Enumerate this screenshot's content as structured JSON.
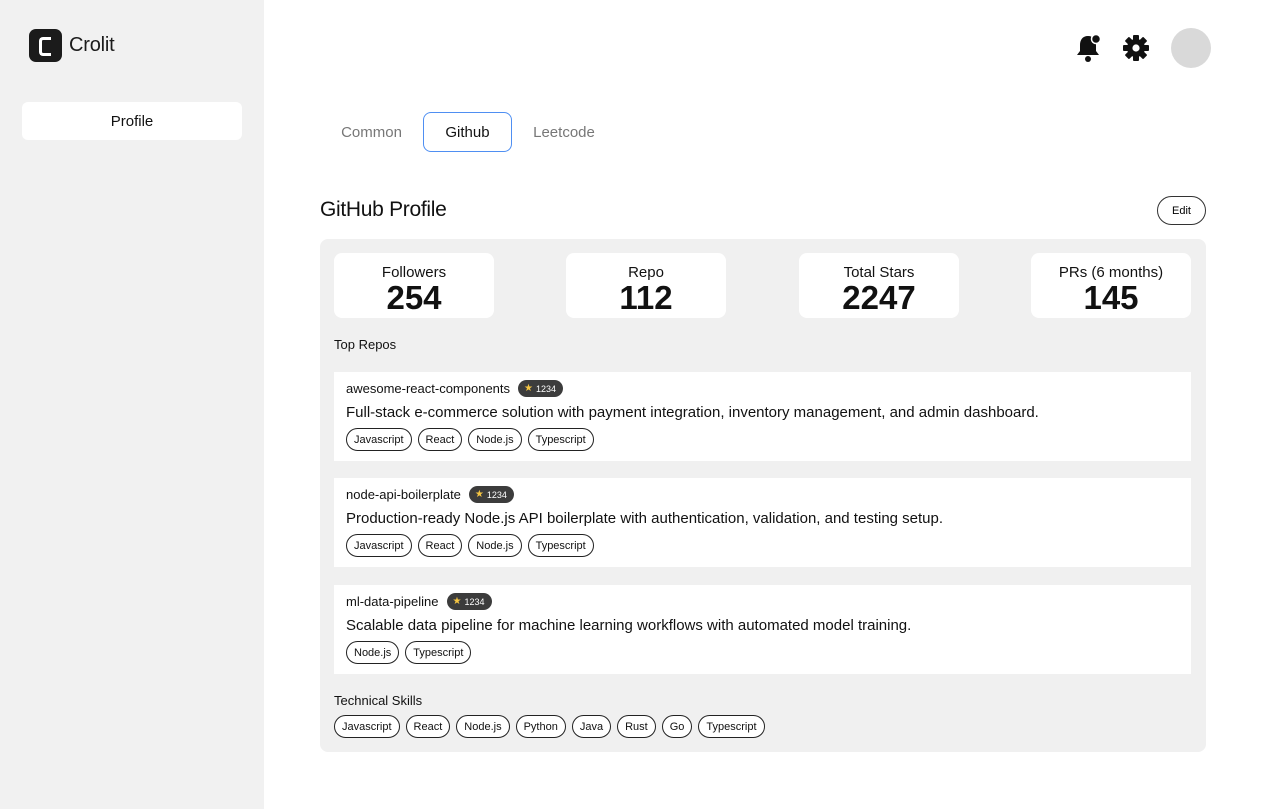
{
  "app": {
    "name": "Crolit"
  },
  "sidebar": {
    "items": [
      {
        "label": "Profile"
      }
    ]
  },
  "tabs": [
    {
      "label": "Common"
    },
    {
      "label": "Github"
    },
    {
      "label": "Leetcode"
    }
  ],
  "page": {
    "title": "GitHub Profile",
    "edit_label": "Edit"
  },
  "stats": [
    {
      "label": "Followers",
      "value": "254"
    },
    {
      "label": "Repo",
      "value": "112"
    },
    {
      "label": "Total Stars",
      "value": "2247"
    },
    {
      "label": "PRs (6 months)",
      "value": "145"
    }
  ],
  "top_repos": {
    "label": "Top Repos",
    "items": [
      {
        "name": "awesome-react-components",
        "stars": "1234",
        "description": "Full-stack e-commerce solution with payment integration, inventory management, and admin dashboard.",
        "tags": [
          "Javascript",
          "React",
          "Node.js",
          "Typescript"
        ]
      },
      {
        "name": "node-api-boilerplate",
        "stars": "1234",
        "description": "Production-ready Node.js API boilerplate with authentication, validation, and testing setup.",
        "tags": [
          "Javascript",
          "React",
          "Node.js",
          "Typescript"
        ]
      },
      {
        "name": "ml-data-pipeline",
        "stars": "1234",
        "description": "Scalable data pipeline for machine learning workflows with automated model training.",
        "tags": [
          "Node.js",
          "Typescript"
        ]
      }
    ]
  },
  "skills": {
    "label": "Technical Skills",
    "items": [
      "Javascript",
      "React",
      "Node.js",
      "Python",
      "Java",
      "Rust",
      "Go",
      "Typescript"
    ]
  },
  "icons": {
    "notifications": "bell-icon",
    "settings": "gear-icon",
    "star": "star-icon"
  },
  "colors": {
    "active_tab_border": "#4f8ff2",
    "star_badge": "#3c3c3c",
    "star": "#f5c542"
  }
}
